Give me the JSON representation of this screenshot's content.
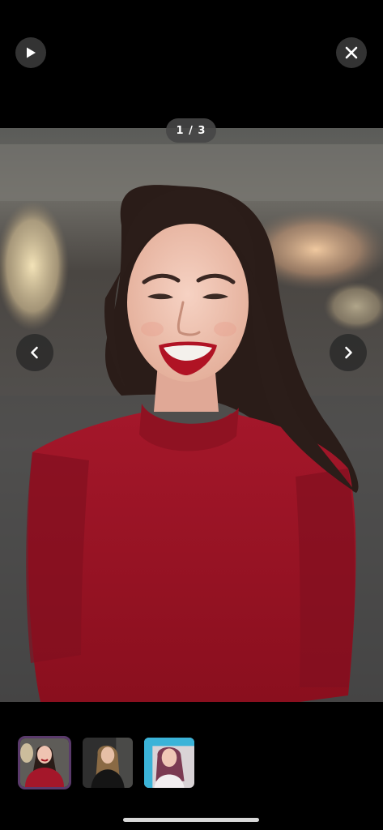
{
  "viewer": {
    "counter": "1 / 3",
    "current_index": 1,
    "total": 3
  },
  "controls": {
    "play_icon": "play-icon",
    "close_icon": "close-icon",
    "prev_icon": "chevron-left-icon",
    "next_icon": "chevron-right-icon"
  },
  "thumbnails": [
    {
      "selected": true
    },
    {
      "selected": false
    },
    {
      "selected": false
    }
  ],
  "colors": {
    "background": "#000000",
    "selected_border": "#5a3a6b",
    "shirt_red": "#9b1422"
  }
}
